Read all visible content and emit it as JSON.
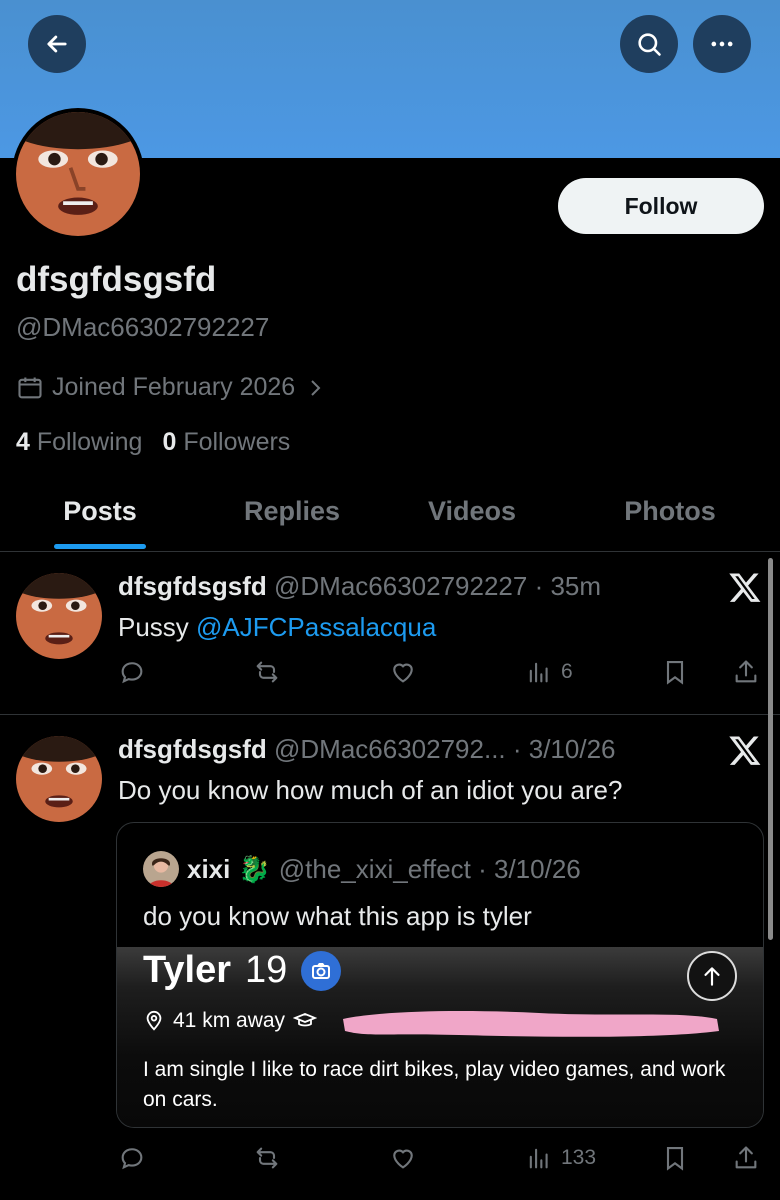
{
  "header": {
    "banner_color": "#4c98e4",
    "back_icon": "arrow-left-icon",
    "search_icon": "search-icon",
    "more_icon": "more-horizontal-icon"
  },
  "profile": {
    "display_name": "dfsgfdsgsfd",
    "handle": "@DMac66302792227",
    "joined": "Joined February 2026",
    "follow_label": "Follow",
    "following_count": "4",
    "following_label": "Following",
    "followers_count": "0",
    "followers_label": "Followers"
  },
  "tabs": [
    {
      "label": "Posts",
      "active": true
    },
    {
      "label": "Replies",
      "active": false
    },
    {
      "label": "Videos",
      "active": false
    },
    {
      "label": "Photos",
      "active": false
    }
  ],
  "posts": [
    {
      "name": "dfsgfdsgsfd",
      "handle_time": "@DMac66302792227 · 35m",
      "text": "Pussy ",
      "mention": "@AJFCPassalacqua",
      "views": "6"
    },
    {
      "name": "dfsgfdsgsfd",
      "handle_time": "@DMac66302792... · 3/10/26",
      "text": "Do you know how much of an idiot you are?",
      "views": "133",
      "quote": {
        "name": "xixi",
        "emoji": "🐉",
        "handle_time": "@the_xixi_effect · 3/10/26",
        "text": "do you know what this app is tyler",
        "image": {
          "name": "Tyler",
          "age": "19",
          "distance": "41 km away",
          "bio": "I am single I like to race dirt bikes, play video games, and work on cars."
        }
      }
    }
  ],
  "colors": {
    "accent": "#1d9bf0",
    "muted": "#71767b",
    "text": "#e7e9ea",
    "redaction": "#f0a6c8"
  }
}
